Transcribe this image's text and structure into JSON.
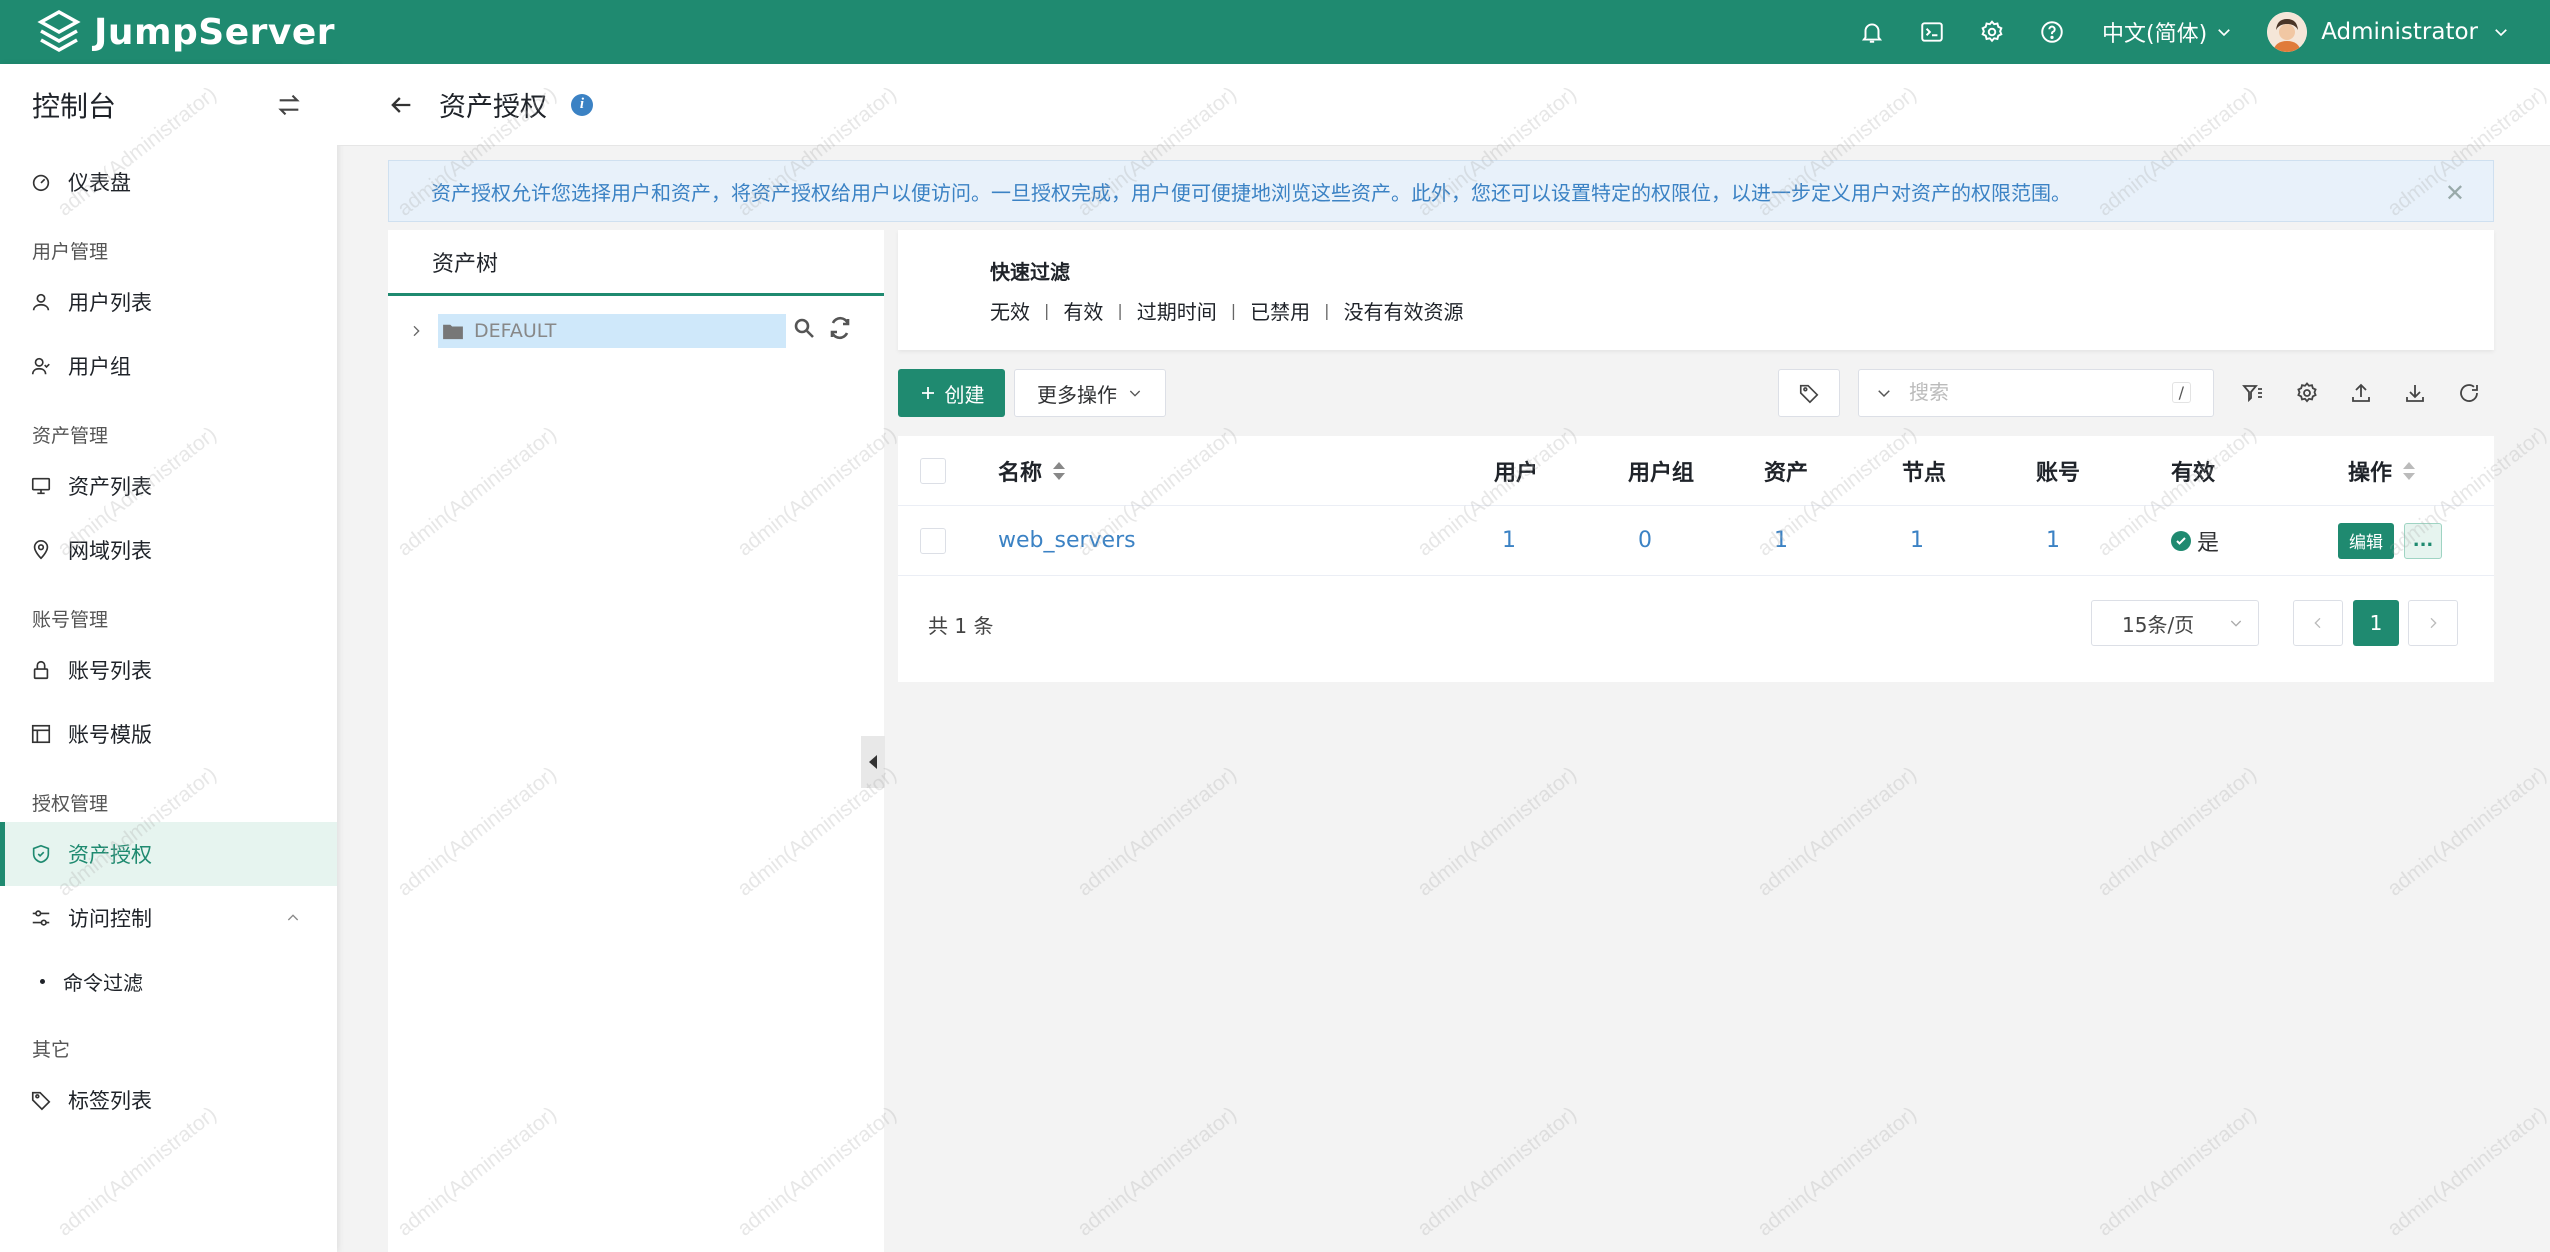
{
  "header": {
    "brand": "JumpServer",
    "language": "中文(简体)",
    "username": "Administrator"
  },
  "sidebar": {
    "title": "控制台",
    "items": {
      "dashboard": "仪表盘",
      "user_mgmt": "用户管理",
      "user_list": "用户列表",
      "user_group": "用户组",
      "asset_mgmt": "资产管理",
      "asset_list": "资产列表",
      "zone_list": "网域列表",
      "account_mgmt": "账号管理",
      "account_list": "账号列表",
      "account_template": "账号模版",
      "perm_mgmt": "授权管理",
      "asset_perm": "资产授权",
      "access_control": "访问控制",
      "command_filter": "命令过滤",
      "other": "其它",
      "label_list": "标签列表"
    }
  },
  "page": {
    "title": "资产授权",
    "alert": "资产授权允许您选择用户和资产，将资产授权给用户以便访问。一旦授权完成，用户便可便捷地浏览这些资产。此外，您还可以设置特定的权限位，以进一步定义用户对资产的权限范围。"
  },
  "tree": {
    "tab": "资产树",
    "node": "DEFAULT"
  },
  "quick_filter": {
    "title": "快速过滤",
    "items": [
      "无效",
      "有效",
      "过期时间",
      "已禁用",
      "没有有效资源"
    ]
  },
  "toolbar": {
    "create": "创建",
    "more": "更多操作",
    "search_placeholder": "搜索",
    "shortcut": "/"
  },
  "table": {
    "columns": {
      "name": "名称",
      "users": "用户",
      "user_groups": "用户组",
      "assets": "资产",
      "nodes": "节点",
      "accounts": "账号",
      "valid": "有效",
      "actions": "操作"
    },
    "rows": [
      {
        "name": "web_servers",
        "users": "1",
        "user_groups": "0",
        "assets": "1",
        "nodes": "1",
        "accounts": "1",
        "valid": "是",
        "edit": "编辑",
        "more": "..."
      }
    ]
  },
  "pagination": {
    "total": "共 1 条",
    "page_size": "15条/页",
    "current": "1"
  },
  "watermark": "admin(Administrator)"
}
